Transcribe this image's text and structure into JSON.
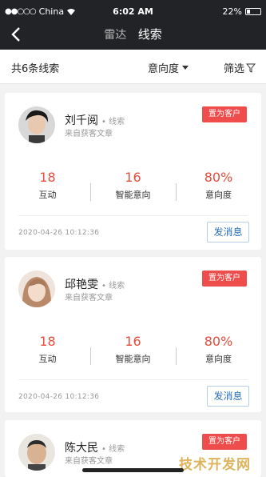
{
  "status": {
    "carrier": "China",
    "time": "6:02 AM",
    "battery": "22%",
    "battery_level": 0.22
  },
  "nav": {
    "tab_radar": "雷达",
    "tab_leads": "线索"
  },
  "filter_bar": {
    "count": "共6条线索",
    "sort": "意向度",
    "filter": "筛选"
  },
  "cards": [
    {
      "name": "刘千阅",
      "tag": "线索",
      "source": "来自获客文章",
      "cust_btn": "置为客户",
      "stats": [
        {
          "value": "18",
          "label": "互动"
        },
        {
          "value": "16",
          "label": "智能意向"
        },
        {
          "value": "80%",
          "label": "意向度"
        }
      ],
      "date": "2020-04-26  10:12:36",
      "msg_btn": "发消息"
    },
    {
      "name": "邱艳雯",
      "tag": "线索",
      "source": "来自获客文章",
      "cust_btn": "置为客户",
      "stats": [
        {
          "value": "18",
          "label": "互动"
        },
        {
          "value": "16",
          "label": "智能意向"
        },
        {
          "value": "80%",
          "label": "意向度"
        }
      ],
      "date": "2020-04-26  10:12:36",
      "msg_btn": "发消息"
    },
    {
      "name": "陈大民",
      "tag": "线索",
      "source": "来自获客文章",
      "cust_btn": "置为客户"
    }
  ],
  "watermark": "技术开发网"
}
